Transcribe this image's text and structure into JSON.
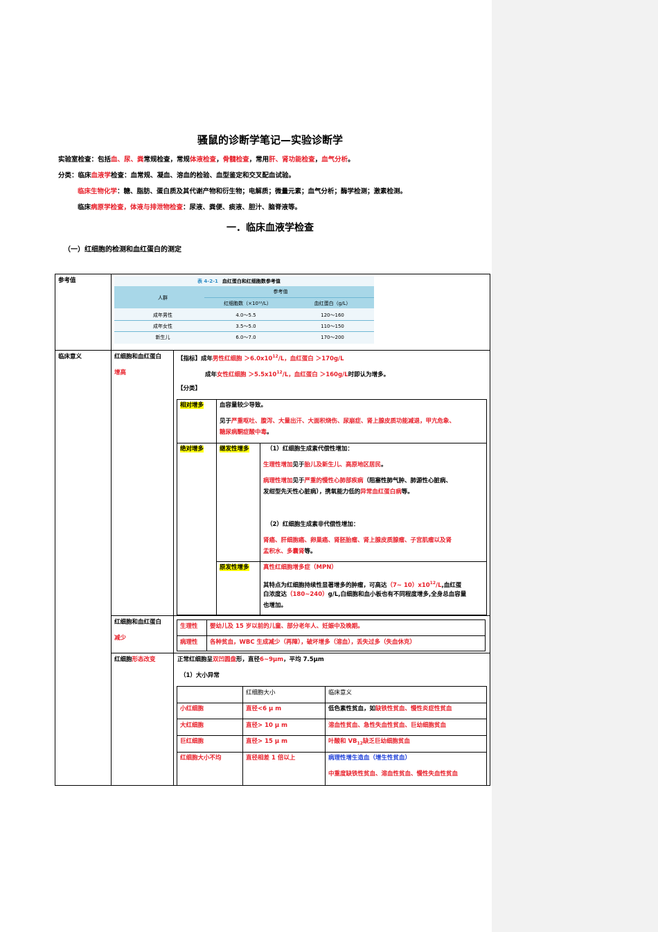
{
  "doc": {
    "title": "骚鼠的诊断学笔记—实验诊断学",
    "intro": {
      "line1": {
        "p1": "实验室检查：包括",
        "p2": "血、尿、粪",
        "p3": "常规检查，常规",
        "p4": "体液检查",
        "p5": "，",
        "p6": "骨髓检查",
        "p7": "，常用",
        "p8": "肝、肾功能检查",
        "p9": "，",
        "p10": "血气分析",
        "p11": "。"
      },
      "line2": {
        "p1": "分类：临床",
        "p2": "血液学",
        "p3": "检查：血常规、凝血、溶血的检验、血型鉴定和交叉配血试验。"
      },
      "line3": {
        "p1": "临床生物化学",
        "p2": "：糖、脂肪、蛋白质及其代谢产物和衍生物；电解质；微量元素；血气分析；酶学检测；激素检测。"
      },
      "line4": {
        "p1": "临床",
        "p2": "病原学检查，体液与排泄物检查",
        "p3": "：尿液、粪便、痰液、胆汁、脑脊液等。"
      }
    },
    "section1": "一．临床血液学检查",
    "subsection1": "（一）红细胞的检测和血红蛋白的测定",
    "table": {
      "row_ref_label": "参考值",
      "ref_image": {
        "caption_num": "表 4-2-1",
        "caption": "血红蛋白和红细胞数参考值",
        "col_group": "人群",
        "col_ref": "参考值",
        "col_rbc": "红细胞数（×10¹²/L）",
        "col_hb": "血红蛋白（g/L）",
        "rows": [
          {
            "group": "成年男性",
            "rbc": "4.0～5.5",
            "hb": "120～160"
          },
          {
            "group": "成年女性",
            "rbc": "3.5～5.0",
            "hb": "110～150"
          },
          {
            "group": "新生儿",
            "rbc": "6.0～7.0",
            "hb": "170～200"
          }
        ]
      },
      "row_clin_label": "临床意义",
      "inc": {
        "label1": "红细胞和血红蛋白",
        "label2": "增高",
        "ind1": {
          "p1": "【指标】成年",
          "p2": "男性红细胞 ＞6.0x10",
          "p3": "12",
          "p4": "/L，血红蛋白 ＞170g/L"
        },
        "ind2": {
          "p1": "成年",
          "p2": "女性红细胞 ＞5.5x10",
          "p3": "12",
          "p4": "/L，血红蛋白 ＞160g/L",
          "p5": "时即认为增多。"
        },
        "cls": "【分类】",
        "rel_label": "相对增多",
        "rel_t1": "血容量较少导致。",
        "rel_t2a": "见于",
        "rel_t2b": "严重呕吐、腹泻、大量出汗、大面积烧伤、尿崩症、肾上腺皮质功能减退，甲亢危象、",
        "rel_t3": "糖尿病酮症酸中毒",
        "rel_t3b": "。",
        "abs_label": "绝对增多",
        "sec_label": "继发性增多",
        "s1": "（1）红细胞生成素代偿性增加：",
        "s2a": "生理性增加",
        "s2b": "见于",
        "s2c": "胎儿及新生儿、高原地区居民",
        "s2d": "。",
        "s3a": "病理性增加",
        "s3b": "见于",
        "s3c": "严重的慢性心肺部疾病",
        "s3d": "（阻塞性肺气肿、肺源性心脏病、",
        "s4a": "发绀型先天性心脏病），携氧能力低的",
        "s4b": "异常血红蛋白病",
        "s4c": "等。",
        "s5": "（2）红细胞生成素非代偿性增加：",
        "s6": "肾癌、肝细胞癌、卵巢癌、肾胚胎瘤、肾上腺皮质腺瘤、子宫肌瘤以及肾",
        "s7a": "盂积水、多囊肾",
        "s7b": "等。",
        "pri_label": "原发性增多",
        "p1": "真性红细胞增多症（MPN）",
        "p2a": "其特点为红细胞持续性显著增多的肿瘤，可高达",
        "p2b": "（7~ 10）x10",
        "p2c": "12",
        "p2d": "/L",
        "p2e": ",血红蛋",
        "p3a": "白浓度达",
        "p3b": "（180~240）",
        "p3c": "g/L,白细胞和血小板也有不同程度增多,全身总血容量",
        "p4": "也增加。"
      },
      "dec": {
        "label1": "红细胞和血红蛋白",
        "label2": "减少",
        "phys_label": "生理性",
        "phys_text": "婴幼儿及 15 岁以前的儿童、部分老年人、妊娠中及晚期。",
        "path_label": "病理性",
        "path_a": "各种贫血，WBC 生成减少（再障），破坏增多（溶血），丢失过多（失血休克）"
      },
      "morph": {
        "label1": "红细胞",
        "label2": "形态改变",
        "l1a": "正常红细胞呈",
        "l1b": "双凹圆盘",
        "l1c": "形，直径",
        "l1d": "6~9μm",
        "l1e": "，平均 7.5μm",
        "l2": "（1）大小异常",
        "hdr_size": "红细胞大小",
        "hdr_sig": "临床意义",
        "rows": [
          {
            "name": "小红细胞",
            "size": "直径<6 μ m",
            "sig_a": "低色素性贫血，如",
            "sig_b": "缺铁性贫血、慢性炎症性贫血"
          },
          {
            "name": "大红细胞",
            "size": "直径> 10 μ m",
            "sig_b": "溶血性贫血、急性失血性贫血、巨幼细胞贫血"
          },
          {
            "name": "巨红细胞",
            "size": "直径> 15 μ m",
            "sig_b": "叶酸和 VB",
            "sig_sub": "12",
            "sig_c": "缺乏巨幼细胞贫血"
          },
          {
            "name": "红细胞大小不均",
            "size": "直径相差 1 倍以上",
            "sig_blue": "病理性增生造血（增生性贫血）",
            "sig_d": "中重度缺铁性贫血、溶血性贫血、慢性失血性贫血"
          }
        ]
      }
    }
  }
}
